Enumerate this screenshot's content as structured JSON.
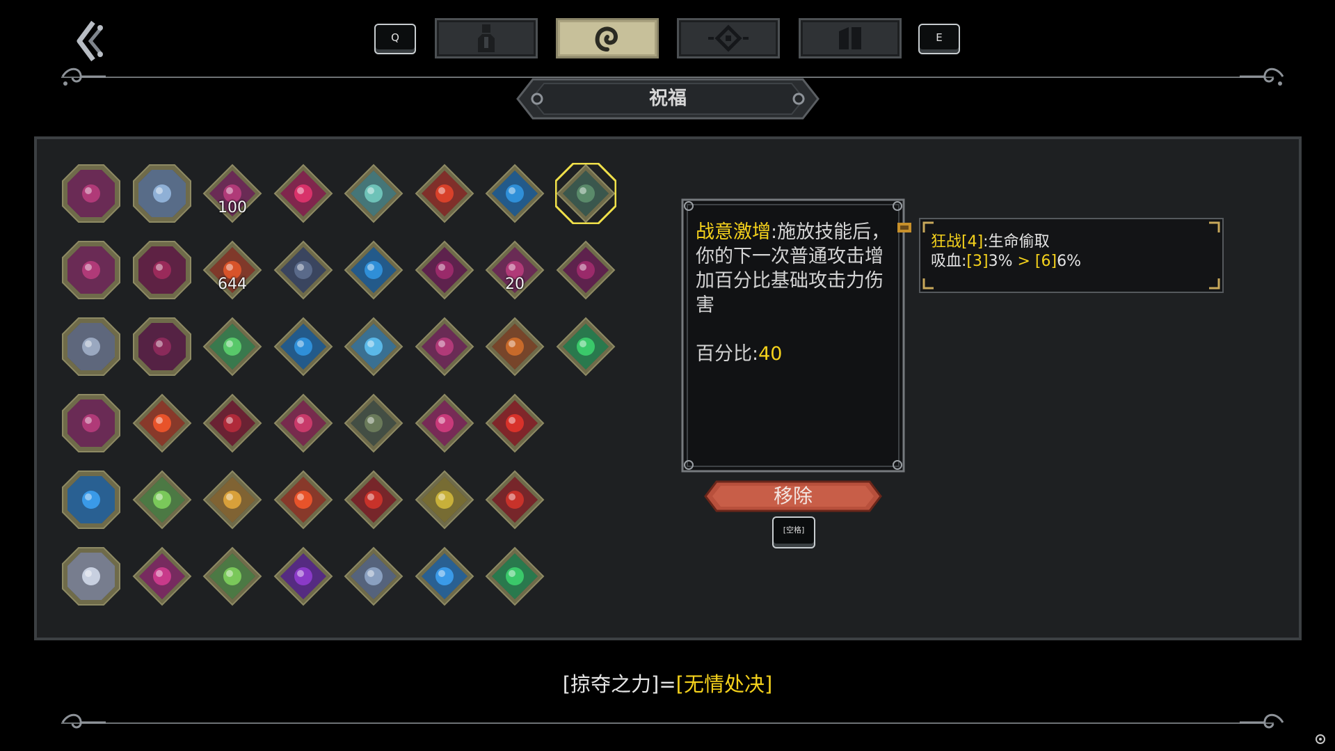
{
  "nav": {
    "back_icon": "back-chevron-icon",
    "prev_key": "Q",
    "next_key": "E",
    "tabs": [
      {
        "icon": "character-icon",
        "active": false
      },
      {
        "icon": "blessing-swirl-icon",
        "active": true
      },
      {
        "icon": "diamond-eye-icon",
        "active": false
      },
      {
        "icon": "inventory-box-icon",
        "active": false
      }
    ]
  },
  "section_title": "祝福",
  "blessings": [
    [
      {
        "shape": "hex",
        "color": "#b03a78",
        "label": ""
      },
      {
        "shape": "hex",
        "color": "#8fb0d6",
        "label": ""
      },
      {
        "shape": "diamond",
        "color": "#b03a78",
        "label": "100"
      },
      {
        "shape": "diamond",
        "color": "#d8326a",
        "label": ""
      },
      {
        "shape": "diamond",
        "color": "#6ec2b8",
        "label": ""
      },
      {
        "shape": "diamond",
        "color": "#d8412a",
        "label": ""
      },
      {
        "shape": "diamond",
        "color": "#2f8fd8",
        "label": ""
      },
      {
        "shape": "diamond",
        "color": "#5a8a6a",
        "label": "",
        "selected": true
      }
    ],
    [
      {
        "shape": "hex",
        "color": "#b03a78",
        "label": ""
      },
      {
        "shape": "hex",
        "color": "#9a2a5a",
        "label": ""
      },
      {
        "shape": "diamond",
        "color": "#d8532a",
        "label": "644"
      },
      {
        "shape": "diamond",
        "color": "#5a6a8a",
        "label": ""
      },
      {
        "shape": "diamond",
        "color": "#2f8fd8",
        "label": ""
      },
      {
        "shape": "diamond",
        "color": "#9a2a6a",
        "label": ""
      },
      {
        "shape": "diamond",
        "color": "#b03a78",
        "label": "20"
      },
      {
        "shape": "diamond",
        "color": "#9a2a6a",
        "label": ""
      }
    ],
    [
      {
        "shape": "hex",
        "color": "#9aa8c0",
        "label": ""
      },
      {
        "shape": "hex",
        "color": "#8a2a5a",
        "label": ""
      },
      {
        "shape": "diamond",
        "color": "#58c86a",
        "label": ""
      },
      {
        "shape": "diamond",
        "color": "#2f8fd8",
        "label": ""
      },
      {
        "shape": "diamond",
        "color": "#5ab8e8",
        "label": ""
      },
      {
        "shape": "diamond",
        "color": "#b03a78",
        "label": ""
      },
      {
        "shape": "diamond",
        "color": "#c86a2a",
        "label": ""
      },
      {
        "shape": "diamond",
        "color": "#3ac86a",
        "label": ""
      }
    ],
    [
      {
        "shape": "hex",
        "color": "#b03a78",
        "label": ""
      },
      {
        "shape": "diamond",
        "color": "#e8532a",
        "label": ""
      },
      {
        "shape": "diamond",
        "color": "#b02a3a",
        "label": ""
      },
      {
        "shape": "diamond",
        "color": "#c83a6a",
        "label": ""
      },
      {
        "shape": "diamond",
        "color": "#6a7a5a",
        "label": ""
      },
      {
        "shape": "diamond",
        "color": "#c83a7a",
        "label": ""
      },
      {
        "shape": "diamond",
        "color": "#d8322a",
        "label": ""
      }
    ],
    [
      {
        "shape": "hex",
        "color": "#3a9ae8",
        "label": ""
      },
      {
        "shape": "diamond",
        "color": "#7ac85a",
        "label": ""
      },
      {
        "shape": "diamond",
        "color": "#d8a03a",
        "label": ""
      },
      {
        "shape": "diamond",
        "color": "#e8532a",
        "label": ""
      },
      {
        "shape": "diamond",
        "color": "#c8322a",
        "label": ""
      },
      {
        "shape": "diamond",
        "color": "#c8b03a",
        "label": ""
      },
      {
        "shape": "diamond",
        "color": "#c8322a",
        "label": ""
      }
    ],
    [
      {
        "shape": "hex",
        "color": "#c8d0e0",
        "label": ""
      },
      {
        "shape": "diamond",
        "color": "#c83a8a",
        "label": ""
      },
      {
        "shape": "diamond",
        "color": "#7ac85a",
        "label": ""
      },
      {
        "shape": "diamond",
        "color": "#8a3ac8",
        "label": ""
      },
      {
        "shape": "diamond",
        "color": "#8aa0c0",
        "label": ""
      },
      {
        "shape": "diamond",
        "color": "#3a9ae8",
        "label": ""
      },
      {
        "shape": "diamond",
        "color": "#3ac86a",
        "label": ""
      }
    ]
  ],
  "detail": {
    "name": "战意激增",
    "description": ":施放技能后，你的下一次普通攻击增加百分比基础攻击力伤害",
    "stat_label": "百分比:",
    "stat_value": "40"
  },
  "set_bonus": {
    "name": "狂战[4]",
    "effect": ":生命偷取",
    "stat_label": "吸血:",
    "from_tier": "[3]",
    "from_value": "3%",
    "arrow": " > ",
    "to_tier": "[6]",
    "to_value": "6%"
  },
  "actions": {
    "remove_label": "移除",
    "remove_key": "[空格]"
  },
  "footer": {
    "left": "[掠夺之力]=",
    "right": "[无情处决]"
  },
  "colors": {
    "highlight": "#f5d21c",
    "tab_active": "#c7c09a",
    "remove_button": "#c0533f",
    "frame": "#6f6b4a"
  }
}
